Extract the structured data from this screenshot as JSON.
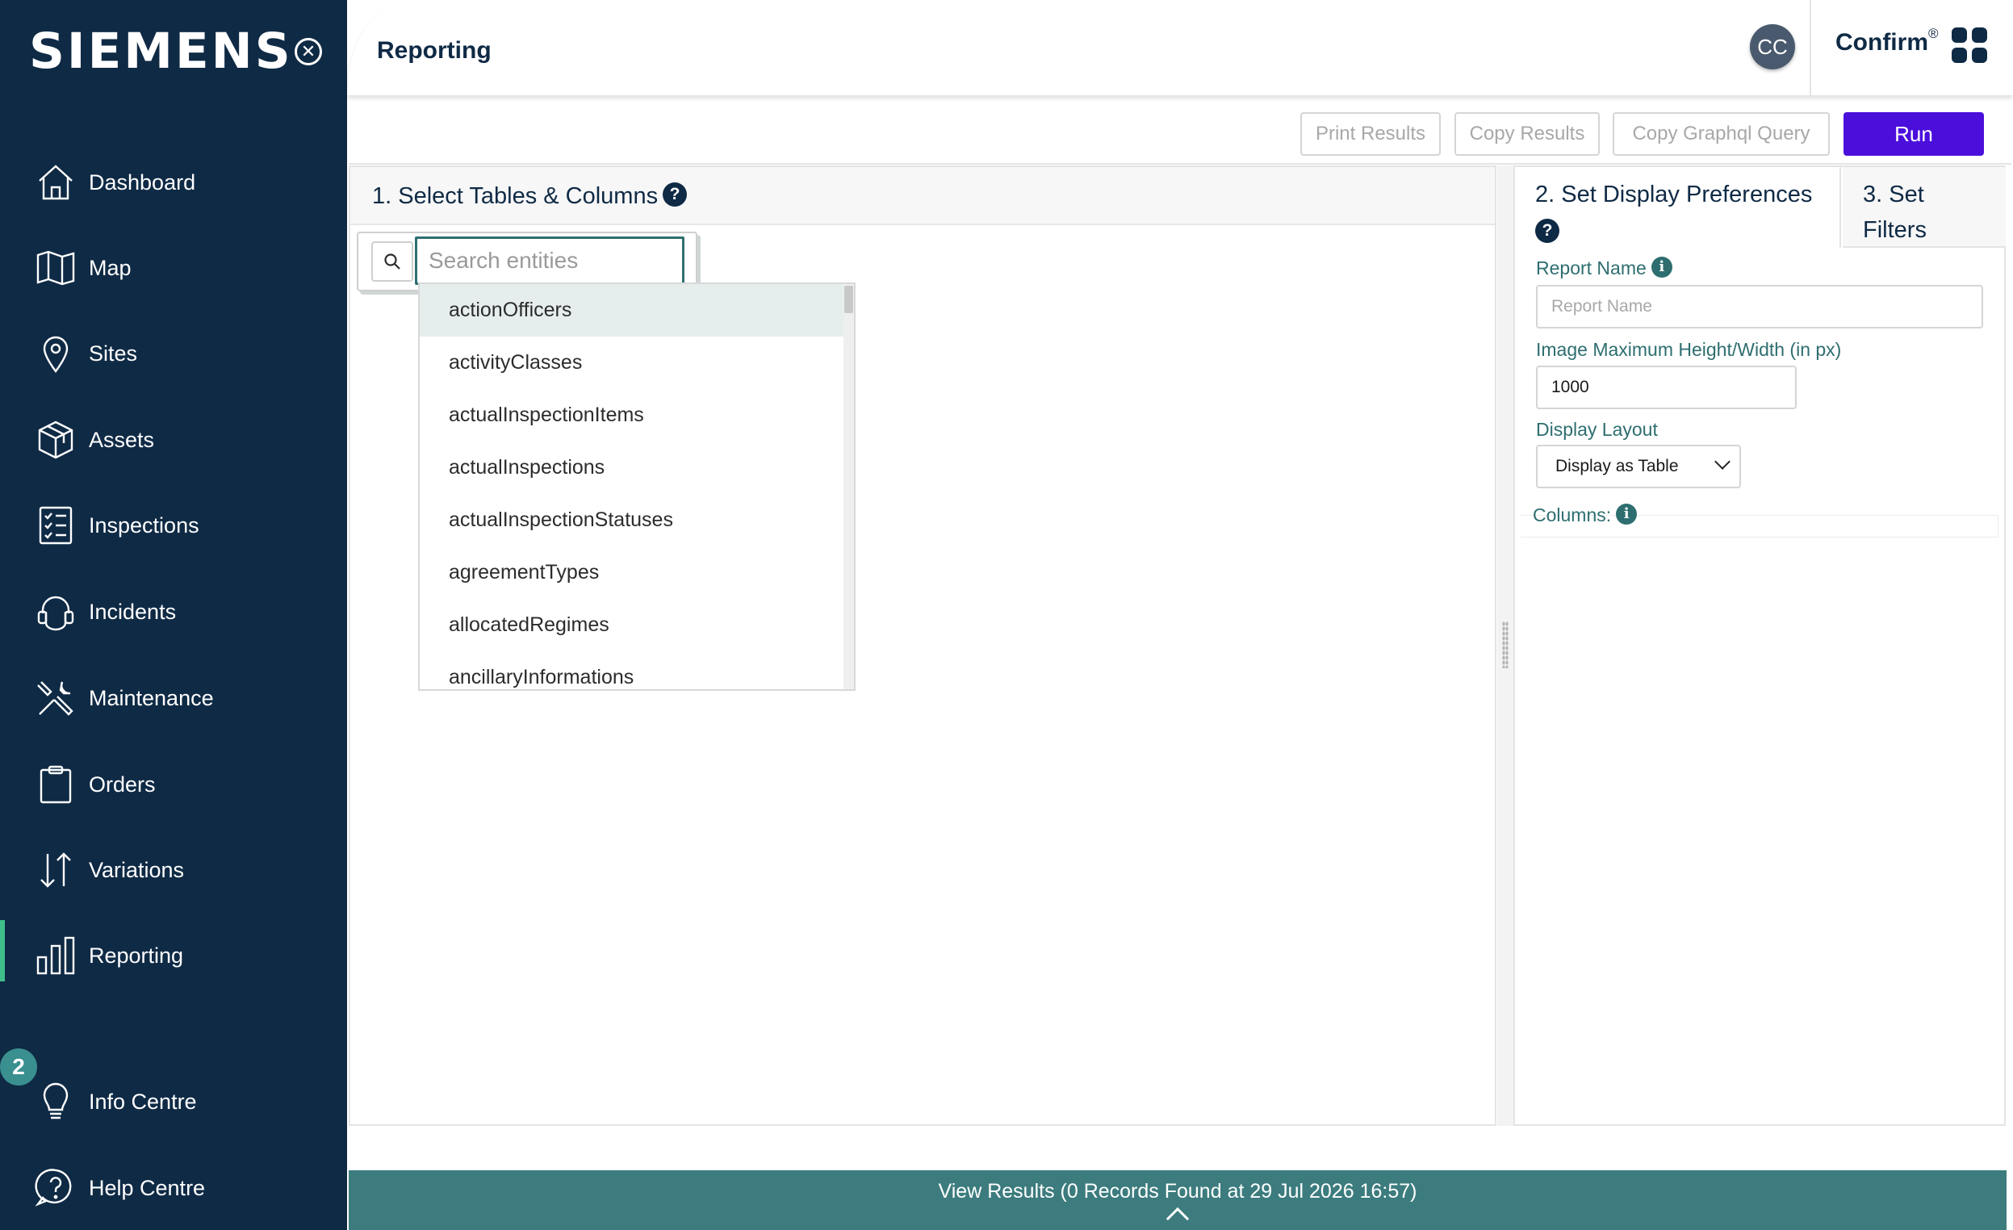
{
  "brand": {
    "logo_text": "SIEMENS",
    "product": "Confirm",
    "product_mark": "®"
  },
  "header": {
    "page_title": "Reporting",
    "avatar_initials": "CC"
  },
  "sidebar": {
    "items": [
      {
        "label": "Dashboard",
        "icon": "house-icon"
      },
      {
        "label": "Map",
        "icon": "map-icon"
      },
      {
        "label": "Sites",
        "icon": "location-pin-icon"
      },
      {
        "label": "Assets",
        "icon": "cube-icon"
      },
      {
        "label": "Inspections",
        "icon": "checklist-icon"
      },
      {
        "label": "Incidents",
        "icon": "headset-icon"
      },
      {
        "label": "Maintenance",
        "icon": "tools-icon"
      },
      {
        "label": "Orders",
        "icon": "clipboard-icon"
      },
      {
        "label": "Variations",
        "icon": "up-down-arrows-icon"
      },
      {
        "label": "Reporting",
        "icon": "bar-chart-icon",
        "active": true
      },
      {
        "label": "Info Centre",
        "icon": "lightbulb-icon",
        "badge": "2"
      },
      {
        "label": "Help Centre",
        "icon": "question-bubble-icon"
      }
    ]
  },
  "toolbar": {
    "print_label": "Print Results",
    "copy_label": "Copy Results",
    "copy_query_label": "Copy Graphql Query",
    "run_label": "Run"
  },
  "select_panel": {
    "title": "1. Select Tables & Columns",
    "search_placeholder": "Search entities",
    "entities": [
      "actionOfficers",
      "activityClasses",
      "actualInspectionItems",
      "actualInspections",
      "actualInspectionStatuses",
      "agreementTypes",
      "allocatedRegimes",
      "ancillaryInformations"
    ],
    "selected_index": 0
  },
  "preferences_panel": {
    "tab_display": "2. Set Display Preferences",
    "tab_filters_line1": "3. Set",
    "tab_filters_line2": "Filters",
    "report_name_label": "Report Name",
    "report_name_placeholder": "Report Name",
    "image_size_label": "Image Maximum Height/Width (in px)",
    "image_size_value": "1000",
    "display_layout_label": "Display Layout",
    "display_layout_value": "Display as Table",
    "columns_label": "Columns:"
  },
  "results_bar": {
    "text": "View Results (0 Records Found at 29 Jul 2026 16:57)"
  },
  "colors": {
    "sidebar_bg": "#0f2a45",
    "accent": "#4b0fdc",
    "teal": "#3d7c7e",
    "active_indicator": "#3fc08a"
  }
}
